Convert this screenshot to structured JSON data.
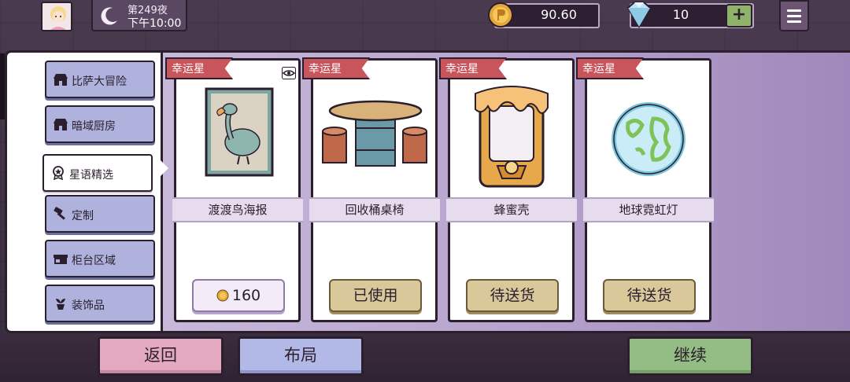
{
  "header": {
    "night_label": "第249夜",
    "time_label": "下午10:00",
    "coins": "90.60",
    "gems": "10",
    "gem_add_label": "+"
  },
  "sidebar": {
    "items": [
      {
        "label": "比萨大冒险",
        "icon": "pizza-shop-icon"
      },
      {
        "label": "暗域厨房",
        "icon": "dark-kitchen-icon"
      },
      {
        "label": "星语精选",
        "icon": "star-badge-icon",
        "active": true
      },
      {
        "label": "定制",
        "icon": "hammer-icon"
      },
      {
        "label": "柜台区域",
        "icon": "counter-icon"
      },
      {
        "label": "装饰品",
        "icon": "plant-pot-icon"
      }
    ]
  },
  "cards": [
    {
      "ribbon": "幸运星",
      "name": "渡渡鸟海报",
      "button": "160",
      "button_type": "price",
      "art": "dodo-poster-icon"
    },
    {
      "ribbon": "幸运星",
      "name": "回收桶桌椅",
      "button": "已使用",
      "button_type": "status",
      "art": "barrel-table-icon"
    },
    {
      "ribbon": "幸运星",
      "name": "蜂蜜壳",
      "button": "待送货",
      "button_type": "status",
      "art": "honey-shell-icon"
    },
    {
      "ribbon": "幸运星",
      "name": "地球霓虹灯",
      "button": "待送货",
      "button_type": "status",
      "art": "earth-neon-icon"
    }
  ],
  "footer": {
    "back_label": "返回",
    "layout_label": "布局",
    "continue_label": "继续"
  },
  "colors": {
    "ribbon": "#c8555b",
    "back_button": "#e3a9bf",
    "layout_button": "#b3b9e6",
    "continue_button": "#93bd85"
  }
}
